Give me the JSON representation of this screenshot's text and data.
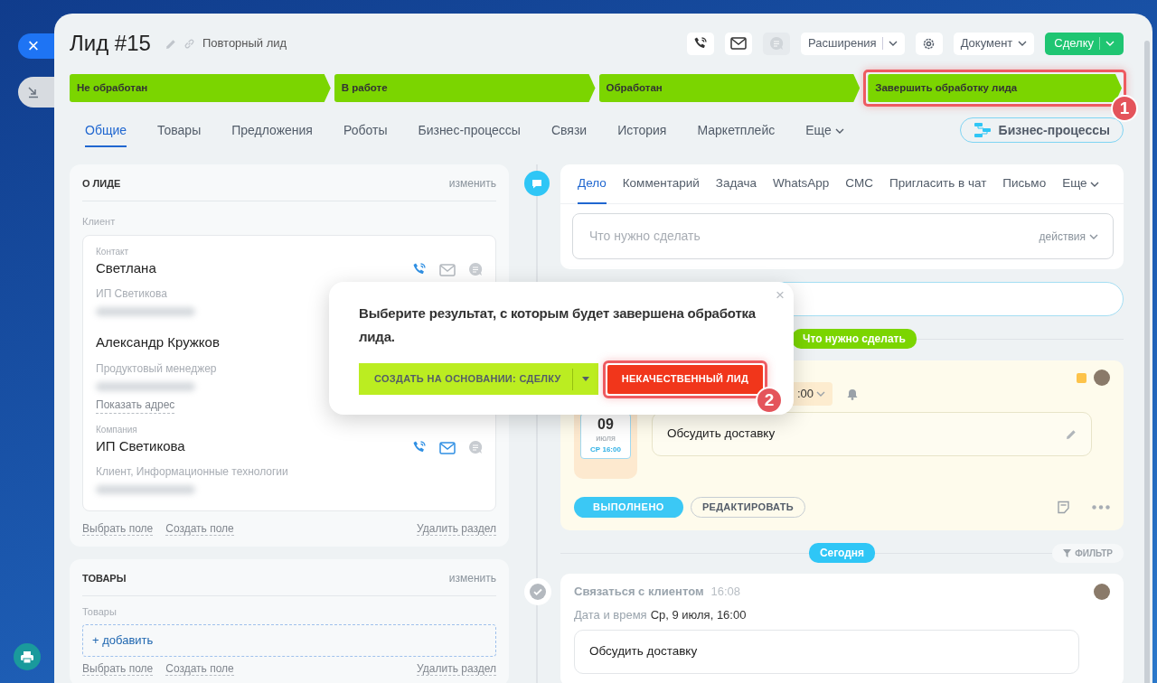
{
  "rail": {
    "close": "×"
  },
  "header": {
    "title": "Лид #15",
    "subtitle": "Повторный лид",
    "chat_disabled": true,
    "extensions": "Расширения",
    "document": "Документ",
    "convert": "Сделку"
  },
  "stages": [
    {
      "label": "Не обработан",
      "highlighted": false
    },
    {
      "label": "В работе",
      "highlighted": false
    },
    {
      "label": "Обработан",
      "highlighted": false
    },
    {
      "label": "Завершить обработку лида",
      "highlighted": true
    }
  ],
  "step_badges": [
    "1",
    "2"
  ],
  "tabs": [
    {
      "label": "Общие",
      "selected": true
    },
    {
      "label": "Товары",
      "selected": false
    },
    {
      "label": "Предложения",
      "selected": false
    },
    {
      "label": "Роботы",
      "selected": false
    },
    {
      "label": "Бизнес-процессы",
      "selected": false
    },
    {
      "label": "Связи",
      "selected": false
    },
    {
      "label": "История",
      "selected": false
    },
    {
      "label": "Маркетплейс",
      "selected": false
    },
    {
      "label": "Еще",
      "kind": "menu",
      "selected": false
    }
  ],
  "bp_button": "Бизнес-процессы",
  "lead_section": {
    "title": "О ЛИДЕ",
    "edit": "изменить",
    "client_label": "Клиент",
    "entries": [
      {
        "caption": "Контакт",
        "name": "Светлана",
        "detail": "ИП Светикова",
        "mail_active": false
      },
      {
        "name": "Александр Кружков",
        "detail": "Продуктовый менеджер",
        "link": "Показать адрес"
      },
      {
        "caption": "Компания",
        "name": "ИП Светикова",
        "detail": "Клиент, Информационные технологии",
        "mail_active": true
      }
    ],
    "footer": [
      "Выбрать поле",
      "Создать поле",
      "Удалить раздел"
    ]
  },
  "products_section": {
    "title": "ТОВАРЫ",
    "edit": "изменить",
    "field_label": "Товары",
    "add": "+ добавить",
    "footer": [
      "Выбрать поле",
      "Создать поле",
      "Удалить раздел"
    ]
  },
  "composer": {
    "tabs": [
      {
        "label": "Дело",
        "selected": true
      },
      {
        "label": "Комментарий",
        "selected": false
      },
      {
        "label": "Задача",
        "selected": false
      },
      {
        "label": "WhatsApp",
        "selected": false
      },
      {
        "label": "СМС",
        "selected": false
      },
      {
        "label": "Пригласить в чат",
        "selected": false
      },
      {
        "label": "Письмо",
        "selected": false
      },
      {
        "label": "Еще",
        "kind": "menu",
        "selected": false
      }
    ],
    "placeholder": "Что нужно сделать",
    "actions": "действия"
  },
  "timeline": {
    "planned_label": "Что нужно сделать",
    "activity": {
      "day": "09",
      "month": "июля",
      "weekday_time": "СР 16:00",
      "time": ":00",
      "description": "Обсудить доставку",
      "done_button": "ВЫПОЛНЕНО",
      "edit_button": "РЕДАКТИРОВАТЬ"
    },
    "today_label": "Сегодня",
    "filter": "ФИЛЬТР",
    "done_item": {
      "title": "Связаться с клиентом",
      "time": "16:08",
      "date_label": "Дата и время",
      "date": "Ср, 9 июля, 16:00",
      "text": "Обсудить доставку"
    }
  },
  "popup": {
    "text": "Выберите результат, с которым будет завершена обработка лида.",
    "primary": "СОЗДАТЬ НА ОСНОВАНИИ: СДЕЛКУ",
    "danger": "НЕКАЧЕСТВЕННЫЙ ЛИД",
    "close": "×"
  }
}
